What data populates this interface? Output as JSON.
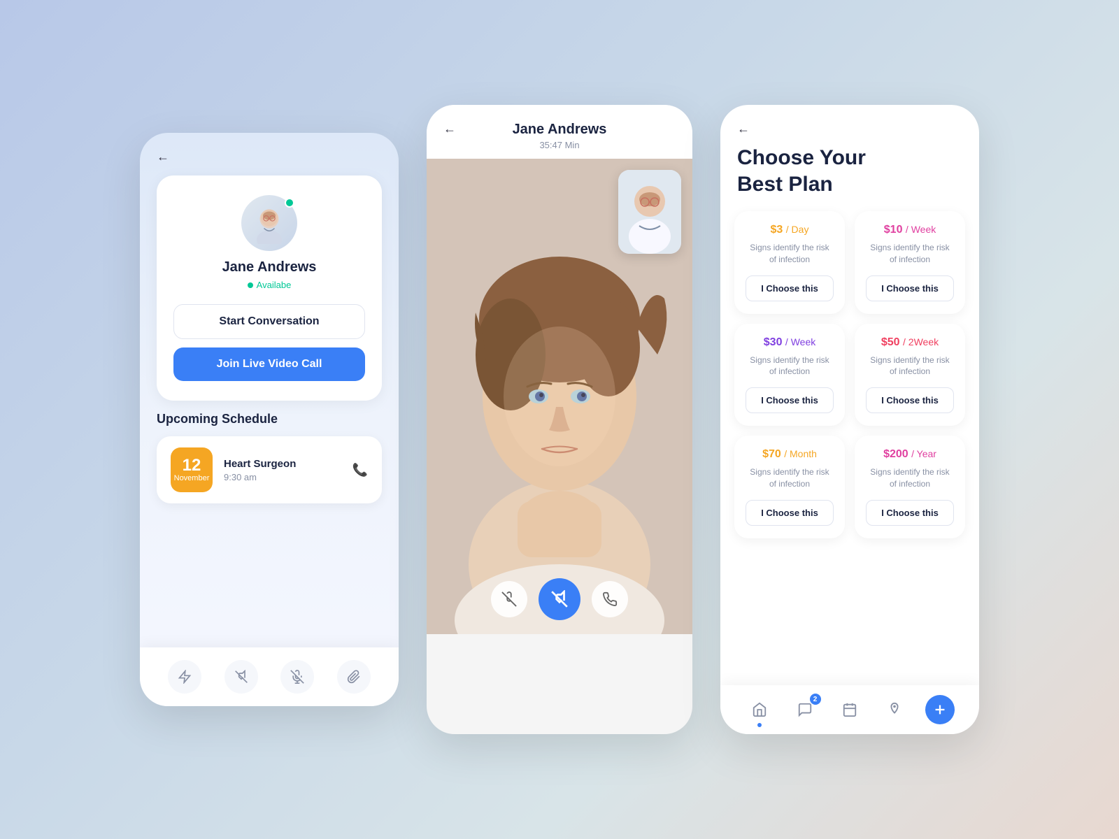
{
  "phone1": {
    "back_label": "←",
    "doctor_name": "Jane Andrews",
    "status": "Availabe",
    "btn_start": "Start Conversation",
    "btn_video": "Join Live Video Call",
    "schedule_title": "Upcoming Schedule",
    "schedule_day": "12",
    "schedule_month": "November",
    "schedule_doctor": "Heart Surgeon",
    "schedule_time": "9:30 am",
    "icons": [
      "⚡",
      "🎥",
      "🎤",
      "📎"
    ]
  },
  "phone2": {
    "back_label": "←",
    "call_name": "Jane Andrews",
    "call_time": "35:47 Min",
    "ctrl_mic": "🎤",
    "ctrl_video": "📷",
    "ctrl_end": "📞"
  },
  "phone3": {
    "back_label": "←",
    "page_title": "Choose Your\nBest Plan",
    "plans": [
      {
        "price": "$3",
        "unit": "/ Day",
        "desc": "Signs identify the risk of infection",
        "btn": "I Choose this",
        "color": "orange"
      },
      {
        "price": "$10",
        "unit": "/ Week",
        "desc": "Signs identify the risk of infection",
        "btn": "I Choose this",
        "color": "pink"
      },
      {
        "price": "$30",
        "unit": "/ Week",
        "desc": "Signs identify the risk of infection",
        "btn": "I Choose this",
        "color": "purple"
      },
      {
        "price": "$50",
        "unit": "/ 2Week",
        "desc": "Signs identify the risk of infection",
        "btn": "I Choose this",
        "color": "red"
      },
      {
        "price": "$70",
        "unit": "/ Month",
        "desc": "Signs identify the risk of infection",
        "btn": "I Choose this",
        "color": "orange"
      },
      {
        "price": "$200",
        "unit": "/ Year",
        "desc": "Signs identify the risk of infection",
        "btn": "I Choose this",
        "color": "pink"
      }
    ],
    "nav_badge": "2"
  }
}
